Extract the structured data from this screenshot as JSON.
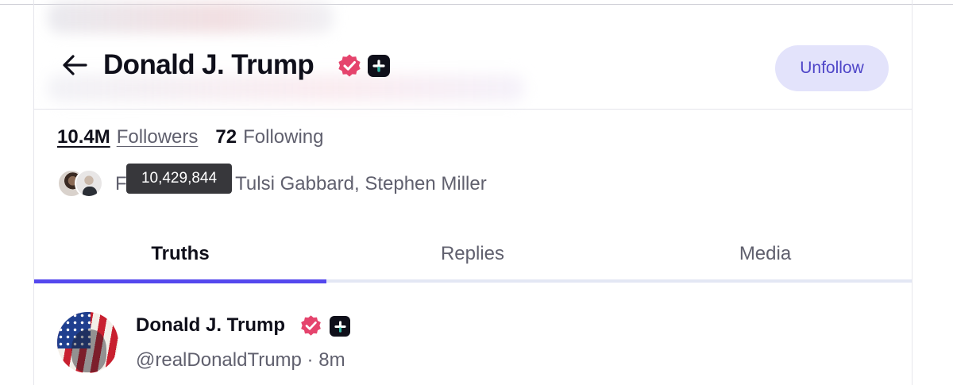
{
  "profile": {
    "display_name": "Donald J. Trump",
    "action_button": "Unfollow"
  },
  "stats": {
    "followers_count": "10.4M",
    "followers_label": "Followers",
    "following_count": "72",
    "following_label": "Following"
  },
  "followed_by": {
    "visible_text": "F                 y, Tulsi Gabbard, Stephen Miller"
  },
  "tooltip": {
    "text": "10,429,844"
  },
  "tabs": [
    {
      "label": "Truths",
      "active": true
    },
    {
      "label": "Replies",
      "active": false
    },
    {
      "label": "Media",
      "active": false
    }
  ],
  "post": {
    "author": "Donald J. Trump",
    "handle_time": "@realDonaldTrump · 8m"
  },
  "icons": {
    "back": "arrow-left-icon",
    "verified": "verified-badge-icon",
    "plus": "plus-badge-icon"
  },
  "colors": {
    "accent": "#5448ee",
    "unfollow_bg": "#e3e3fb",
    "unfollow_text": "#4f46c8",
    "verified": "#e5446d",
    "tooltip_bg": "#37373b"
  }
}
